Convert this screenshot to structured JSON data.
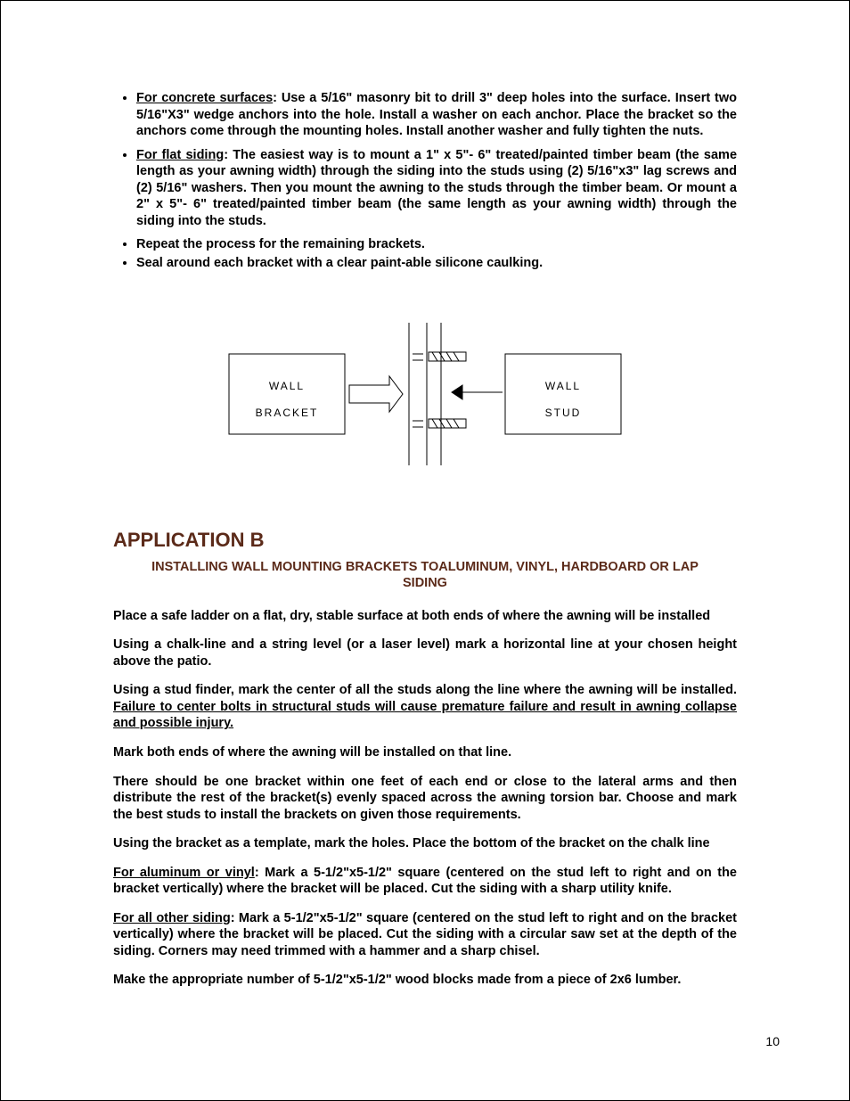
{
  "bullets": {
    "b1_label": "For concrete surfaces",
    "b1_text": ": Use a 5/16\" masonry bit to drill 3\" deep holes into the surface.  Insert two 5/16\"X3\" wedge anchors into the hole. Install a washer on each anchor. Place the bracket so the anchors come through the mounting holes. Install another washer and fully tighten the nuts.",
    "b2_label": "For flat siding",
    "b2_text": ": The easiest way is to mount a 1\" x 5\"- 6\" treated/painted timber beam (the same length as your awning width) through the siding into the studs using (2) 5/16\"x3\" lag screws and (2) 5/16\" washers.  Then you mount the awning to the studs through the timber beam.   Or mount a 2\" x 5\"- 6\" treated/painted timber beam (the same length as your awning width) through the siding into the studs.",
    "b3_text": "Repeat the process for the remaining brackets.",
    "b4_text": "Seal around each bracket with a clear paint-able silicone caulking."
  },
  "diagram": {
    "left_top": "WALL",
    "left_bottom": "BRACKET",
    "right_top": "WALL",
    "right_bottom": "STUD"
  },
  "appB": {
    "heading": "APPLICATION B",
    "subheading": "INSTALLING WALL MOUNTING BRACKETS TOALUMINUM, VINYL, HARDBOARD OR LAP SIDING",
    "p1": "Place a safe ladder on a flat, dry, stable surface at both ends of where the awning will be installed",
    "p2": "Using a chalk-line and a string level (or a laser level) mark a horizontal line at your chosen height above the patio.",
    "p3a": "Using a stud finder, mark the center of all the studs along the line where the awning will be installed.   ",
    "p3b": "Failure to center bolts in structural studs will cause premature failure and result in awning collapse and possible injury.",
    "p4": "Mark both ends of where the awning will be installed on that line.",
    "p5": "There should be one bracket within one feet of each end or close to the lateral arms and then distribute the rest of the bracket(s) evenly spaced across the awning torsion bar. Choose and mark the best studs to install the brackets on given those requirements.",
    "p6": "Using the bracket as a template, mark the holes. Place the bottom of the bracket on the chalk line",
    "p7_label": "For aluminum or vinyl",
    "p7_text": ": Mark a 5-1/2\"x5-1/2\" square (centered on the stud left to right and on the bracket vertically) where the bracket will be placed. Cut the siding with a sharp utility knife.",
    "p8_label": "For all other siding",
    "p8_text": ": Mark a 5-1/2\"x5-1/2\" square (centered on the stud left to right and on the bracket vertically) where the bracket will be placed. Cut the siding with a circular saw set at the depth of the siding. Corners may need trimmed with a hammer and a sharp chisel.",
    "p9": "Make the appropriate number of 5-1/2\"x5-1/2\" wood blocks made from a piece of 2x6 lumber."
  },
  "page_number": "10"
}
